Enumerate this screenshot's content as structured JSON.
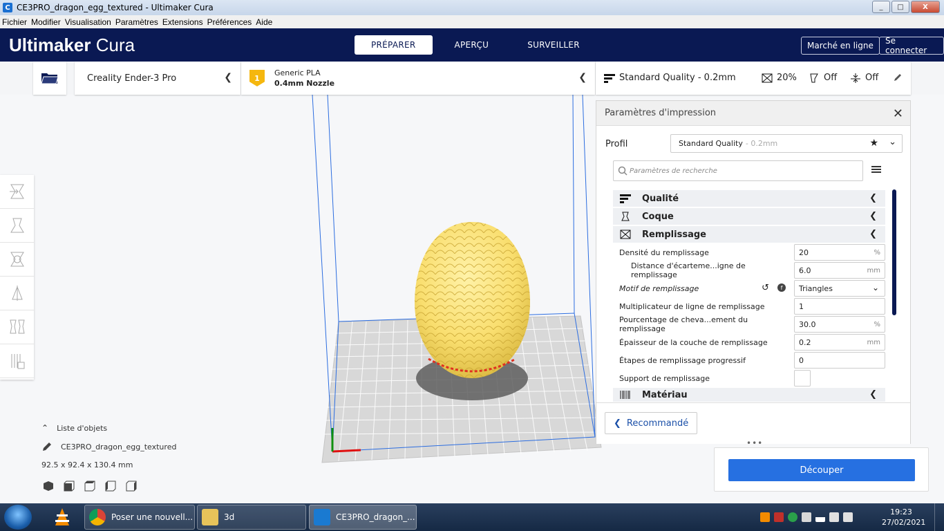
{
  "window": {
    "title": "CE3PRO_dragon_egg_textured - Ultimaker Cura",
    "app_icon": "C",
    "min": "_",
    "max": "□",
    "close": "X"
  },
  "menubar": [
    "Fichier",
    "Modifier",
    "Visualisation",
    "Paramètres",
    "Extensions",
    "Préférences",
    "Aide"
  ],
  "header": {
    "brand_bold": "Ultimaker",
    "brand_light": "Cura",
    "tabs": [
      "PRÉPARER",
      "APERÇU",
      "SURVEILLER"
    ],
    "active_tab": "PRÉPARER",
    "marketplace": "Marché en ligne",
    "signin": "Se connecter"
  },
  "toolbar": {
    "machine": "Creality Ender-3 Pro",
    "extruder_number": "1",
    "material": "Generic PLA",
    "nozzle": "0.4mm Nozzle",
    "quality": "Standard Quality - 0.2mm",
    "infill": "20%",
    "support": "Off",
    "adhesion": "Off"
  },
  "panel": {
    "title": "Paramètres d'impression",
    "profile_label": "Profil",
    "profile_value": "Standard Quality",
    "profile_dim": "- 0.2mm",
    "search_placeholder": "Paramètres de recherche",
    "categories": {
      "quality": "Qualité",
      "shell": "Coque",
      "infill": "Remplissage",
      "material": "Matériau"
    },
    "settings": [
      {
        "label": "Densité du remplissage",
        "value": "20",
        "unit": "%"
      },
      {
        "label": "Distance d'écarteme...igne de remplissage",
        "value": "6.0",
        "unit": "mm"
      },
      {
        "label": "Motif de remplissage",
        "value": "Triangles",
        "unit": ""
      },
      {
        "label": "Multiplicateur de ligne de remplissage",
        "value": "1",
        "unit": ""
      },
      {
        "label": "Pourcentage de cheva...ement du remplissage",
        "value": "30.0",
        "unit": "%"
      },
      {
        "label": "Épaisseur de la couche de remplissage",
        "value": "0.2",
        "unit": "mm"
      },
      {
        "label": "Étapes de remplissage progressif",
        "value": "0",
        "unit": ""
      },
      {
        "label": "Support de remplissage",
        "value": "",
        "unit": ""
      }
    ],
    "recommended": "Recommandé"
  },
  "objects": {
    "header": "Liste d'objets",
    "name": "CE3PRO_dragon_egg_textured",
    "dims": "92.5 x 92.4 x 130.4 mm"
  },
  "slice_button": "Découper",
  "taskbar": {
    "tasks": [
      "Poser une nouvell...",
      "3d",
      "CE3PRO_dragon_..."
    ],
    "time": "19:23",
    "date": "27/02/2021"
  },
  "colors": {
    "header": "#0a1953",
    "accent": "#2670e1",
    "egg": "#f9de6e",
    "badge": "#f5b70f"
  }
}
